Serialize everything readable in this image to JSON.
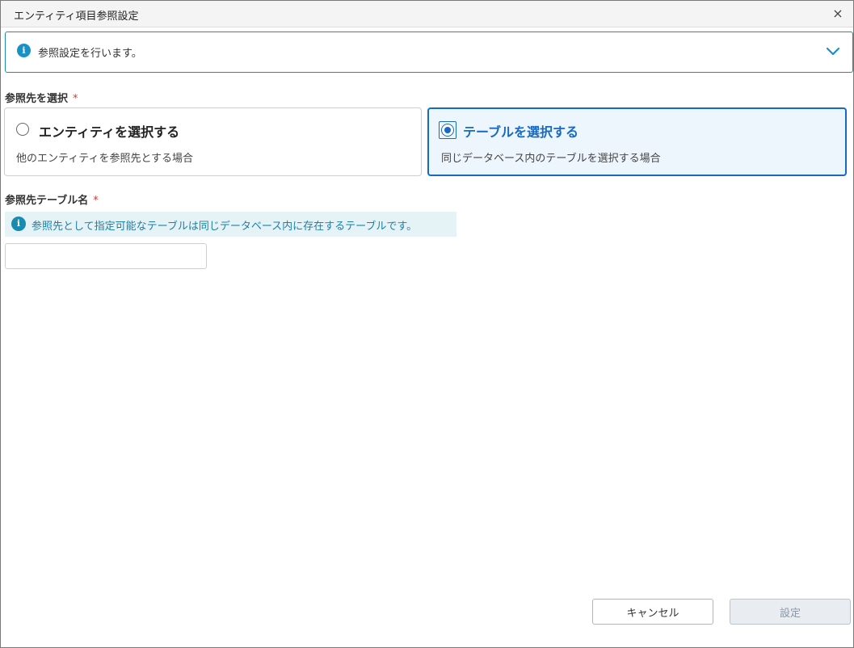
{
  "dialog": {
    "title": "エンティティ項目参照設定",
    "close_symbol": "×"
  },
  "info_panel": {
    "icon": "info-icon",
    "icon_glyph": "i",
    "message": "参照設定を行います。",
    "toggle_icon": "chevron-down-icon"
  },
  "reference_target": {
    "label": "参照先を選択",
    "required_mark": "*",
    "options": [
      {
        "title": "エンティティを選択する",
        "description": "他のエンティティを参照先とする場合",
        "selected": false
      },
      {
        "title": "テーブルを選択する",
        "description": "同じデータベース内のテーブルを選択する場合",
        "selected": true
      }
    ]
  },
  "reference_table": {
    "label": "参照先テーブル名",
    "required_mark": "*",
    "hint": "参照先として指定可能なテーブルは同じデータベース内に存在するテーブルです。",
    "hint_icon_glyph": "i",
    "value": ""
  },
  "footer": {
    "cancel_label": "キャンセル",
    "submit_label": "設定"
  },
  "colors": {
    "accent": "#1769c4",
    "info": "#1890c8",
    "required": "#d23a3a",
    "hint_bg": "#e6f3f6"
  }
}
